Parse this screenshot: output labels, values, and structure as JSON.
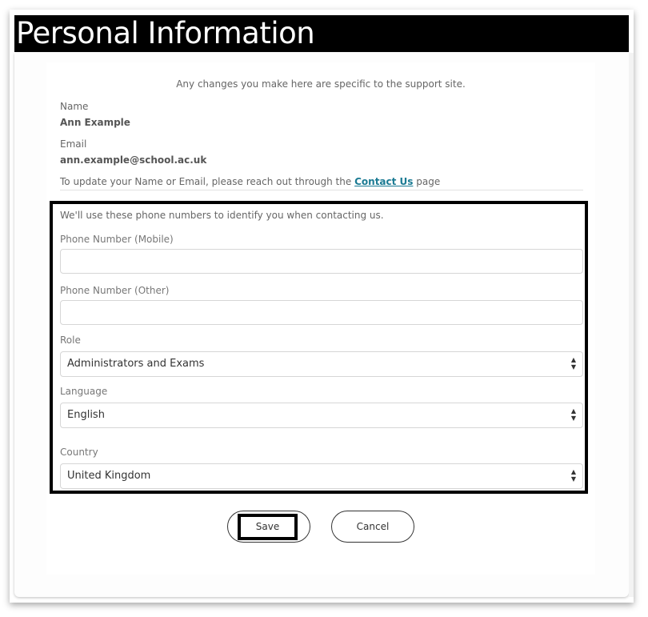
{
  "header": {
    "title": "Personal Information"
  },
  "intro_note": "Any changes you make here are specific to the support site.",
  "profile": {
    "name_label": "Name",
    "name_value": "Ann Example",
    "email_label": "Email",
    "email_value": "ann.example@school.ac.uk",
    "update_text_before": "To update your Name or Email, please reach out through the",
    "contact_link": "Contact Us",
    "update_text_after": "page"
  },
  "phone_section": {
    "note": "We'll use these phone numbers to identify you when contacting us.",
    "mobile_label": "Phone Number (Mobile)",
    "mobile_value": "",
    "other_label": "Phone Number (Other)",
    "other_value": "",
    "role_label": "Role",
    "role_value": "Administrators and Exams",
    "language_label": "Language",
    "language_value": "English",
    "country_label": "Country",
    "country_value": "United Kingdom"
  },
  "icons": {
    "select_arrows": "up-down-arrows-icon"
  },
  "actions": {
    "save_label": "Save",
    "cancel_label": "Cancel"
  },
  "colors": {
    "link": "#1a7a93",
    "header_bg": "#000000",
    "header_text": "#ffffff"
  }
}
